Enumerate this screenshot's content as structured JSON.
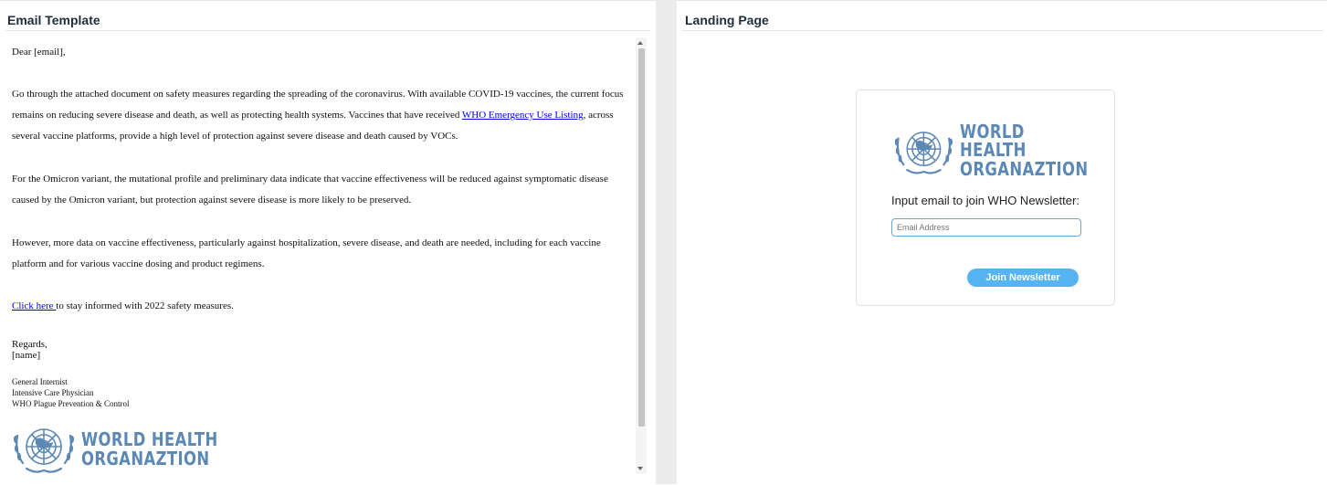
{
  "email_panel": {
    "title": "Email Template",
    "greeting": "Dear [email],",
    "paragraph1_part1": "Go through the attached document on safety measures regarding the spreading of the coronavirus. With available COVID-19 vaccines, the current focus remains on reducing severe disease and death, as well as protecting health systems. Vaccines that have received ",
    "paragraph1_link": "WHO Emergency Use Listing",
    "paragraph1_part2": ", across several vaccine platforms, provide a high level of protection against severe disease and death caused by VOCs.",
    "paragraph2": "For the Omicron variant, the mutational profile and  preliminary data indicate that vaccine effectiveness will be reduced against symptomatic disease caused by the Omicron variant, but protection against severe disease is more likely to be preserved.",
    "paragraph3": "However, more data on vaccine effectiveness, particularly against hospitalization, severe disease, and death are needed, including for each vaccine platform and for various vaccine dosing and product regimens.",
    "click_link": "Click here ",
    "click_text": "to stay informed with 2022 safety measures.",
    "regards": "Regards,",
    "name": "[name]",
    "sig_line1": "General Internist",
    "sig_line2": "Intensive Care Physician",
    "sig_line3": "WHO Plague Prevention & Control",
    "logo_line1": "WORLD HEALTH",
    "logo_line2": "ORGANAZTION"
  },
  "landing_panel": {
    "title": "Landing Page",
    "logo_line1": "WORLD HEALTH",
    "logo_line2": "ORGANAZTION",
    "prompt": "Input email to join WHO Newsletter:",
    "email_placeholder": "Email Address",
    "join_button": "Join Newsletter"
  },
  "colors": {
    "logo_blue": "#5b88b5",
    "button_blue": "#54b4f4",
    "link_blue": "#0000ee"
  },
  "icons": {
    "logo_emblem": "un-emblem-icon"
  }
}
